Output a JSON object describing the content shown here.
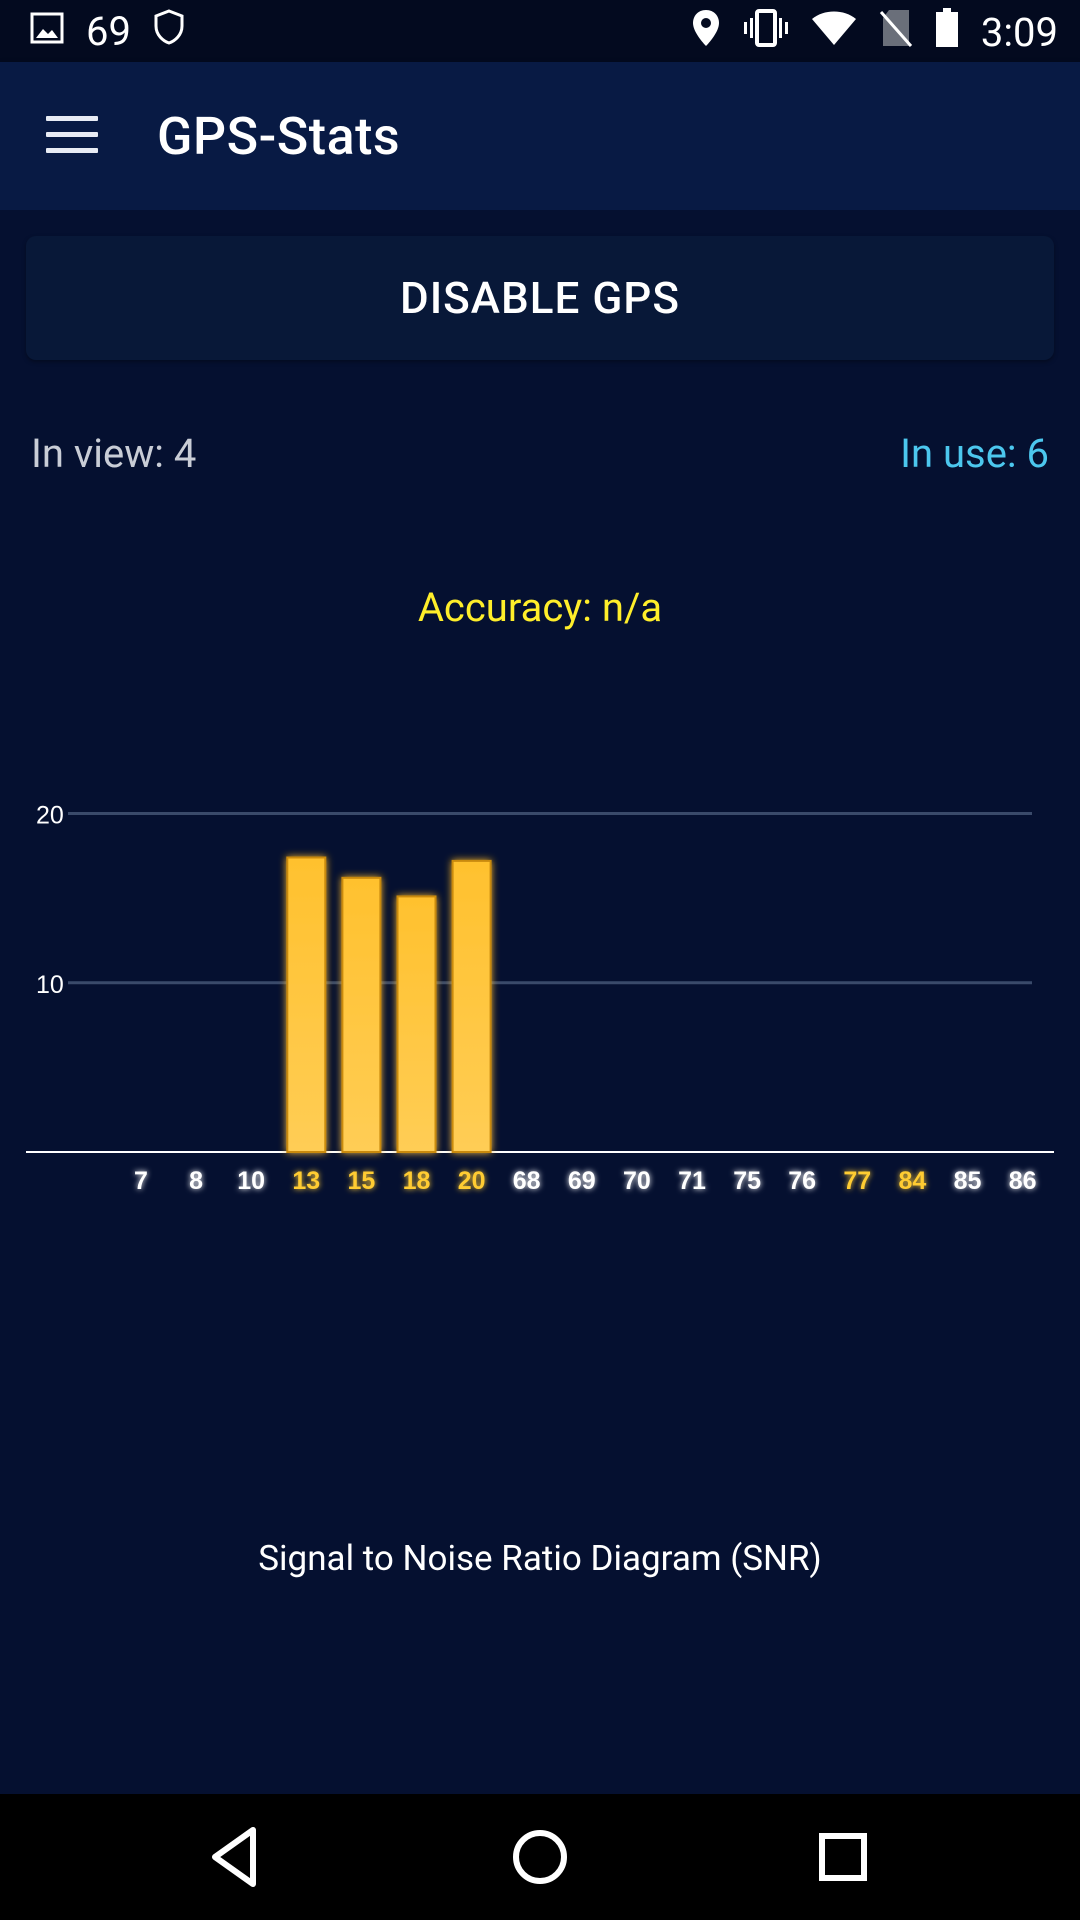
{
  "status_bar": {
    "notification_count": "69",
    "time": "3:09"
  },
  "app_bar": {
    "title": "GPS-Stats"
  },
  "main": {
    "disable_button_label": "DISABLE GPS",
    "in_view_label": "In view: 4",
    "in_use_label": "In use: 6",
    "accuracy_label": "Accuracy: n/a",
    "chart_caption": "Signal to Noise Ratio Diagram (SNR)"
  },
  "colors": {
    "background": "#051030",
    "app_bar": "#081a44",
    "accent_blue": "#4cc7ee",
    "accuracy_yellow": "#ffee2a",
    "bar_fill": "#ffc12e",
    "used_label": "#ffcc33"
  },
  "chart_data": {
    "type": "bar",
    "title": "Signal to Noise Ratio Diagram (SNR)",
    "xlabel": "",
    "ylabel": "",
    "ylim": [
      0,
      40
    ],
    "yticks": [
      10,
      20,
      30,
      40
    ],
    "grid": true,
    "categories": [
      "7",
      "8",
      "10",
      "13",
      "15",
      "18",
      "20",
      "68",
      "69",
      "70",
      "71",
      "75",
      "76",
      "77",
      "84",
      "85",
      "86"
    ],
    "values": [
      0,
      0,
      0,
      17.4,
      16.2,
      15.1,
      17.2,
      0,
      0,
      0,
      0,
      0,
      0,
      0,
      0,
      0,
      0
    ],
    "in_use": [
      false,
      false,
      false,
      true,
      true,
      true,
      true,
      false,
      false,
      false,
      false,
      false,
      false,
      true,
      true,
      false,
      false
    ]
  },
  "nav_bar": {
    "back_icon": "back-triangle-icon",
    "home_icon": "home-circle-icon",
    "recents_icon": "recents-square-icon"
  }
}
